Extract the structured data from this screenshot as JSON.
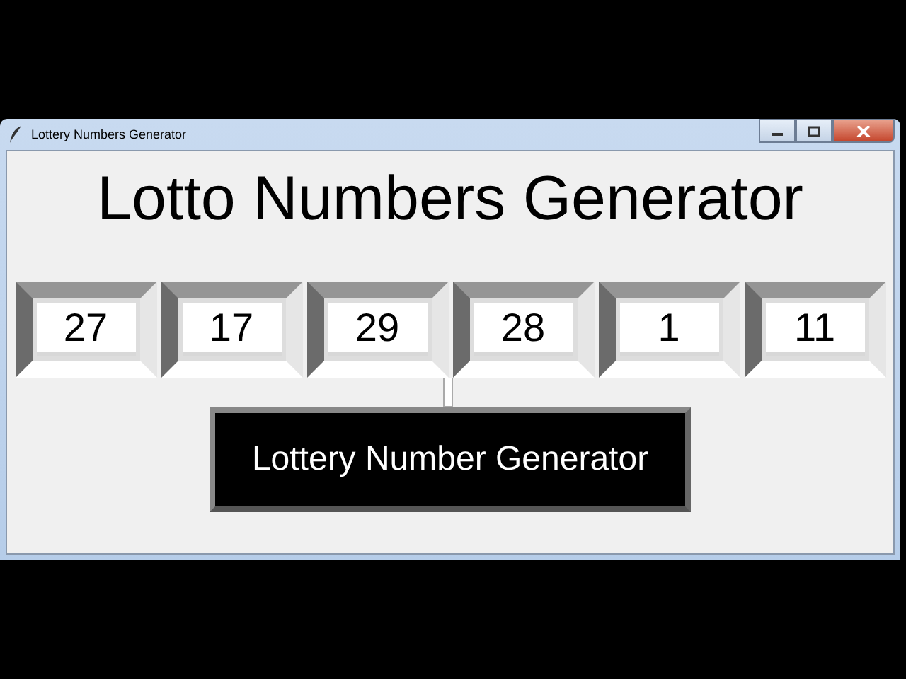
{
  "window": {
    "title": "Lottery Numbers Generator"
  },
  "heading": "Lotto Numbers Generator",
  "numbers": [
    "27",
    "17",
    "29",
    "28",
    "1",
    "11"
  ],
  "button": "Lottery Number Generator"
}
